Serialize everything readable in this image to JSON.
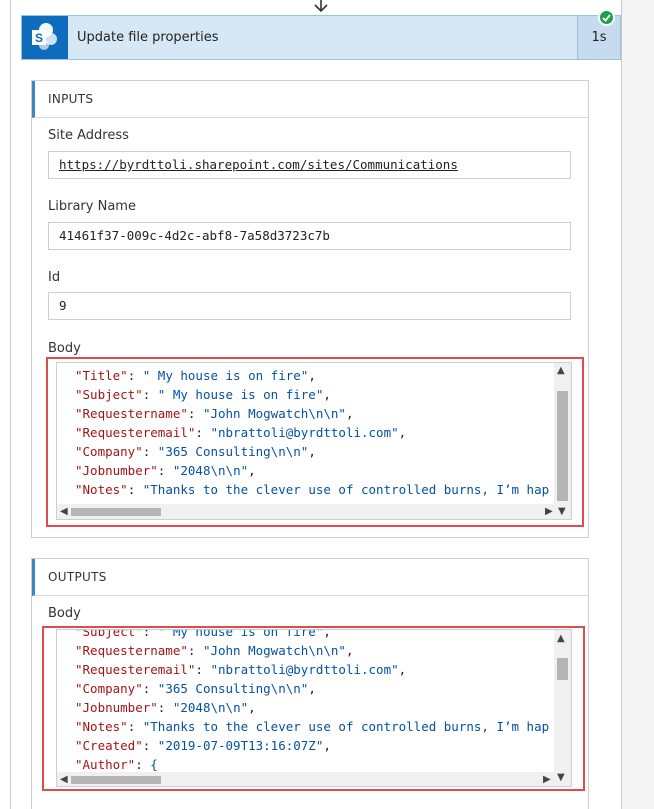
{
  "action": {
    "title": "Update file properties",
    "duration": "1s",
    "status": "succeeded"
  },
  "inputs": {
    "section_label": "INPUTS",
    "site_address": {
      "label": "Site Address",
      "value": "https://byrdttoli.sharepoint.com/sites/Communications"
    },
    "library_name": {
      "label": "Library Name",
      "value": "41461f37-009c-4d2c-abf8-7a58d3723c7b"
    },
    "id": {
      "label": "Id",
      "value": "9"
    },
    "body": {
      "label": "Body",
      "lines": [
        {
          "key": "\"Title\"",
          "value": "\" My house is on fire\"",
          "tail": ","
        },
        {
          "key": "\"Subject\"",
          "value": "\" My house is on fire\"",
          "tail": ","
        },
        {
          "key": "\"Requestername\"",
          "value": "\"John Mogwatch\\n\\n\"",
          "tail": ","
        },
        {
          "key": "\"Requesteremail\"",
          "value": "\"nbrattoli@byrdttoli.com\"",
          "tail": ","
        },
        {
          "key": "\"Company\"",
          "value": "\"365 Consulting\\n\\n\"",
          "tail": ","
        },
        {
          "key": "\"Jobnumber\"",
          "value": "\"2048\\n\\n\"",
          "tail": ","
        },
        {
          "key": "\"Notes\"",
          "value": "\"Thanks to the clever use of controlled burns, I’m hap",
          "tail": ""
        }
      ]
    }
  },
  "outputs": {
    "section_label": "OUTPUTS",
    "body": {
      "label": "Body",
      "lines": [
        {
          "key": "\"Subject\"",
          "value": "\" My house is on fire\"",
          "tail": ","
        },
        {
          "key": "\"Requestername\"",
          "value": "\"John Mogwatch\\n\\n\"",
          "tail": ","
        },
        {
          "key": "\"Requesteremail\"",
          "value": "\"nbrattoli@byrdttoli.com\"",
          "tail": ","
        },
        {
          "key": "\"Company\"",
          "value": "\"365 Consulting\\n\\n\"",
          "tail": ","
        },
        {
          "key": "\"Jobnumber\"",
          "value": "\"2048\\n\\n\"",
          "tail": ","
        },
        {
          "key": "\"Notes\"",
          "value": "\"Thanks to the clever use of controlled burns, I’m hap",
          "tail": ""
        },
        {
          "key": "\"Created\"",
          "value": "\"2019-07-09T13:16:07Z\"",
          "tail": ","
        },
        {
          "key": "\"Author\"",
          "value": "{",
          "tail": ""
        }
      ]
    }
  },
  "colors": {
    "key": "#a31515",
    "string": "#0451a5",
    "highlight": "#e04b4b",
    "accent": "#0f6cbd"
  }
}
